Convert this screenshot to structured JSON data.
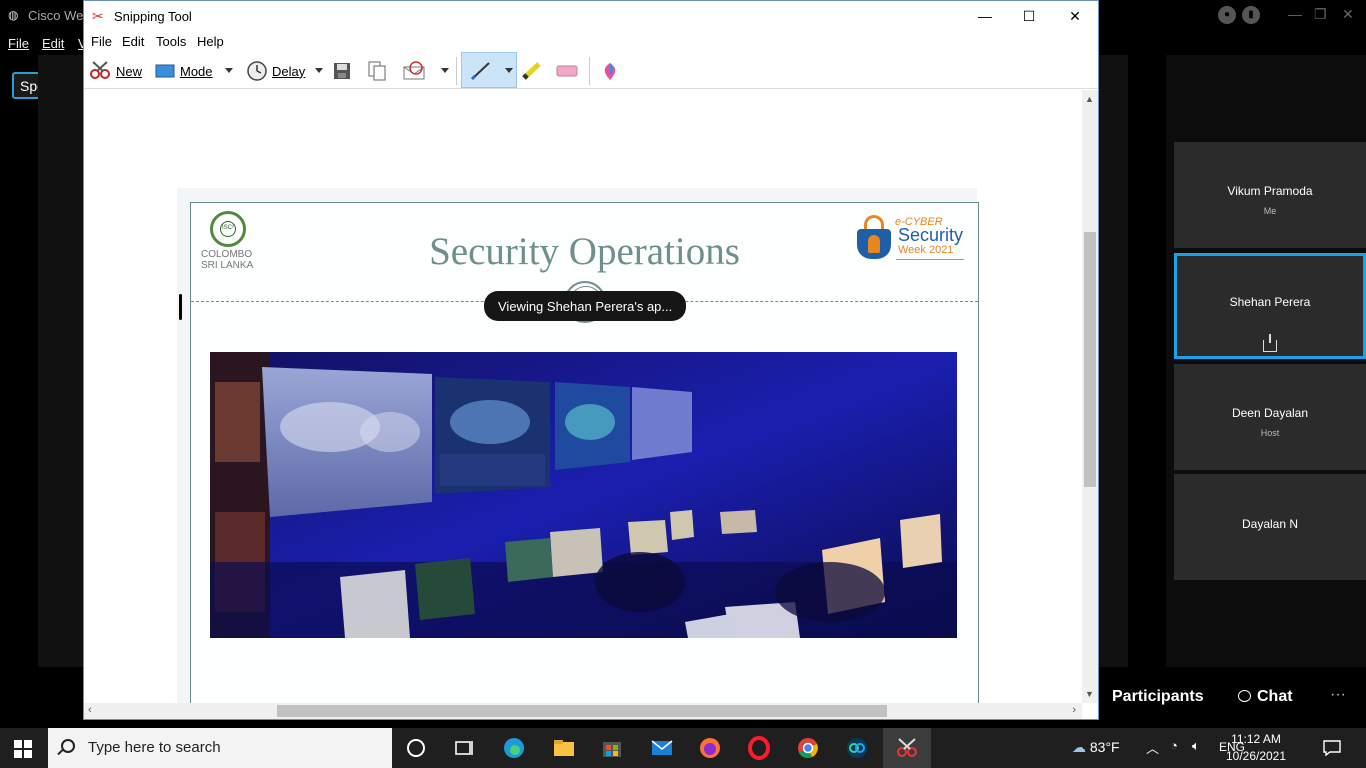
{
  "webex": {
    "title": "Cisco Web",
    "menu": [
      "File",
      "Edit",
      "V"
    ],
    "speaking_label": "Speaking:",
    "participants": [
      {
        "name": "Vikum Pramoda",
        "role": "Me",
        "active": false
      },
      {
        "name": "Shehan Perera",
        "role": "",
        "active": true,
        "sharing": true
      },
      {
        "name": "Deen Dayalan",
        "role": "Host",
        "active": false
      },
      {
        "name": "Dayalan N",
        "role": "",
        "active": false
      }
    ],
    "bottom": {
      "participants_label": "Participants",
      "chat_label": "Chat",
      "more_label": "···"
    }
  },
  "snipping_tool": {
    "title": "Snipping Tool",
    "window_buttons": {
      "minimize": "—",
      "maximize": "☐",
      "close": "✕"
    },
    "menu": [
      "File",
      "Edit",
      "Tools",
      "Help"
    ],
    "toolbar": {
      "new_label": "New",
      "mode_label": "Mode",
      "delay_label": "Delay"
    }
  },
  "slide": {
    "title": "Security Operations",
    "isc_logo": {
      "badge_text": "ISC²",
      "line1": "COLOMBO",
      "line2": "SRI LANKA"
    },
    "event_logo": {
      "line1": "e-CYBER",
      "line2": "Security",
      "line3": "Week 2021"
    }
  },
  "viewing_banner": "Viewing Shehan Perera's ap...",
  "taskbar": {
    "search_placeholder": "Type here to search",
    "weather": "83°F",
    "language": "ENG",
    "time": "11:12 AM",
    "date": "10/26/2021"
  },
  "colors": {
    "accent": "#1aa3e8",
    "slide_teal": "#6f8f8c",
    "tile_bg": "#2b2b2b"
  }
}
